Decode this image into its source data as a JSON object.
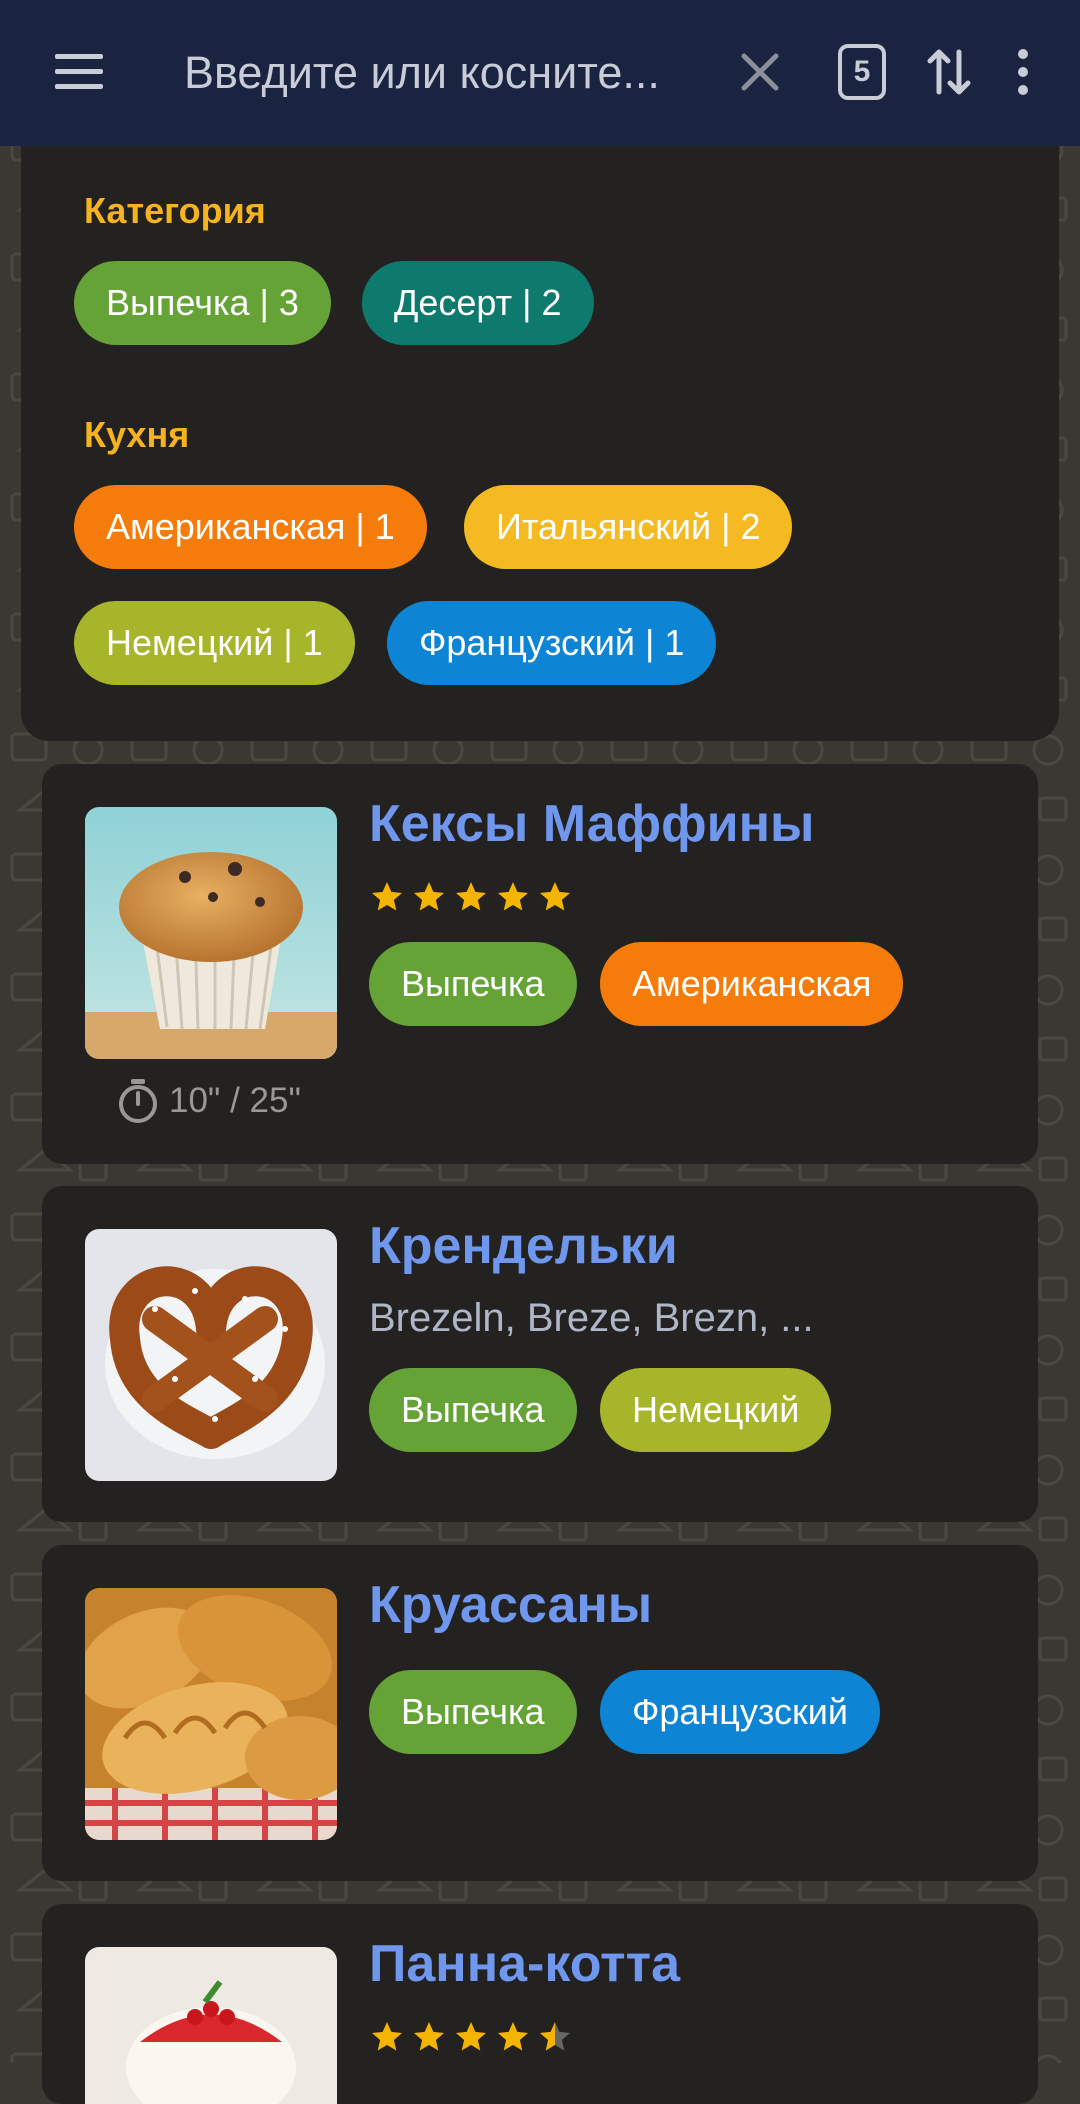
{
  "search": {
    "placeholder": "Введите или косните...",
    "count_badge": "5"
  },
  "filters": {
    "category_title": "Категория",
    "category_chips": [
      {
        "label": "Выпечка | 3",
        "color": "#66a336"
      },
      {
        "label": "Десерт | 2",
        "color": "#0e7a6e"
      }
    ],
    "cuisine_title": "Кухня",
    "cuisine_chips": [
      {
        "label": "Американская | 1",
        "color": "#f57c0b"
      },
      {
        "label": "Итальянский | 2",
        "color": "#f5b922"
      },
      {
        "label": "Немецкий | 1",
        "color": "#a7b52a"
      },
      {
        "label": "Французский | 1",
        "color": "#0d84d4"
      }
    ]
  },
  "recipes": [
    {
      "title": "Кексы Маффины",
      "rating": 5,
      "tags": [
        {
          "label": "Выпечка",
          "color": "#66a336"
        },
        {
          "label": "Американская",
          "color": "#f57c0b"
        }
      ],
      "time": "10\" / 25\""
    },
    {
      "title": "Крендельки",
      "subtitle": "Brezeln, Breze, Brezn, ...",
      "tags": [
        {
          "label": "Выпечка",
          "color": "#66a336"
        },
        {
          "label": "Немецкий",
          "color": "#a7b52a"
        }
      ]
    },
    {
      "title": "Круассаны",
      "tags": [
        {
          "label": "Выпечка",
          "color": "#66a336"
        },
        {
          "label": "Французский",
          "color": "#0d84d4"
        }
      ]
    },
    {
      "title": "Панна-котта",
      "rating": 4.5
    }
  ],
  "colors": {
    "accent_title": "#6f97ee",
    "section_title": "#f5b31f",
    "star": "#f5b400",
    "topbar": "#1a2340"
  }
}
